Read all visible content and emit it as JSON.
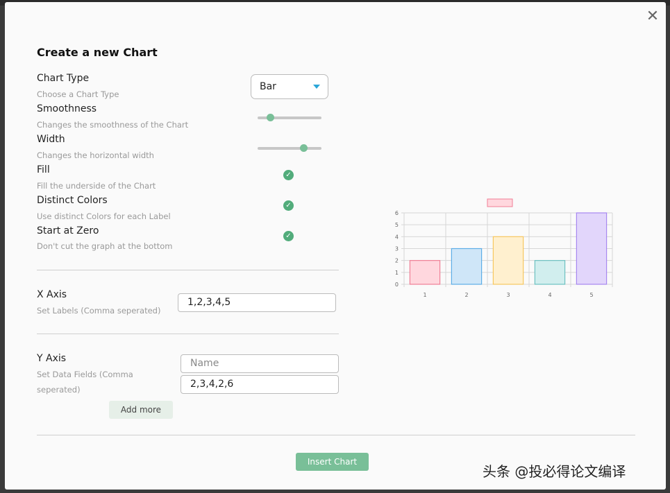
{
  "dialog": {
    "title": "Create a new Chart",
    "close_icon": "close-icon"
  },
  "settings": {
    "chart_type": {
      "label": "Chart Type",
      "description": "Choose a Chart Type",
      "value": "Bar"
    },
    "smoothness": {
      "label": "Smoothness",
      "description": "Changes the smoothness of the Chart",
      "level": 0.2
    },
    "width": {
      "label": "Width",
      "description": "Changes the horizontal width",
      "level": 0.72
    },
    "fill": {
      "label": "Fill",
      "description": "Fill the underside of the Chart",
      "checked": true
    },
    "distinct_colors": {
      "label": "Distinct Colors",
      "description": "Use distinct Colors for each Label",
      "checked": true
    },
    "start_at_zero": {
      "label": "Start at Zero",
      "description": "Don't cut the graph at the bottom",
      "checked": true
    }
  },
  "x_axis": {
    "label": "X Axis",
    "description": "Set Labels (Comma seperated)",
    "value": "1,2,3,4,5"
  },
  "y_axis": {
    "label": "Y Axis",
    "description_line1": "Set Data Fields (Comma",
    "description_line2": "seperated)",
    "name_placeholder": "Name",
    "value": "2,3,4,2,6",
    "add_more_label": "Add more"
  },
  "insert_button_label": "Insert Chart",
  "watermark": "头条 @投必得论文编译",
  "colors": {
    "accent_green": "#52ac7b",
    "button_green": "#79bf98",
    "caret_blue": "#2aa6d8"
  },
  "chart_data": {
    "type": "bar",
    "categories": [
      "1",
      "2",
      "3",
      "4",
      "5"
    ],
    "values": [
      2,
      3,
      4,
      2,
      6
    ],
    "ylim": [
      0,
      6
    ],
    "yticks": [
      0,
      1,
      2,
      3,
      4,
      5,
      6
    ],
    "grid": true,
    "legend": "top",
    "fills": [
      "#ffd7de",
      "#cfe6f8",
      "#fff0cf",
      "#d1eeee",
      "#e2d6fb"
    ],
    "strokes": [
      "#f07f96",
      "#5daee7",
      "#f7c75f",
      "#6cc1c1",
      "#a787f0"
    ]
  }
}
